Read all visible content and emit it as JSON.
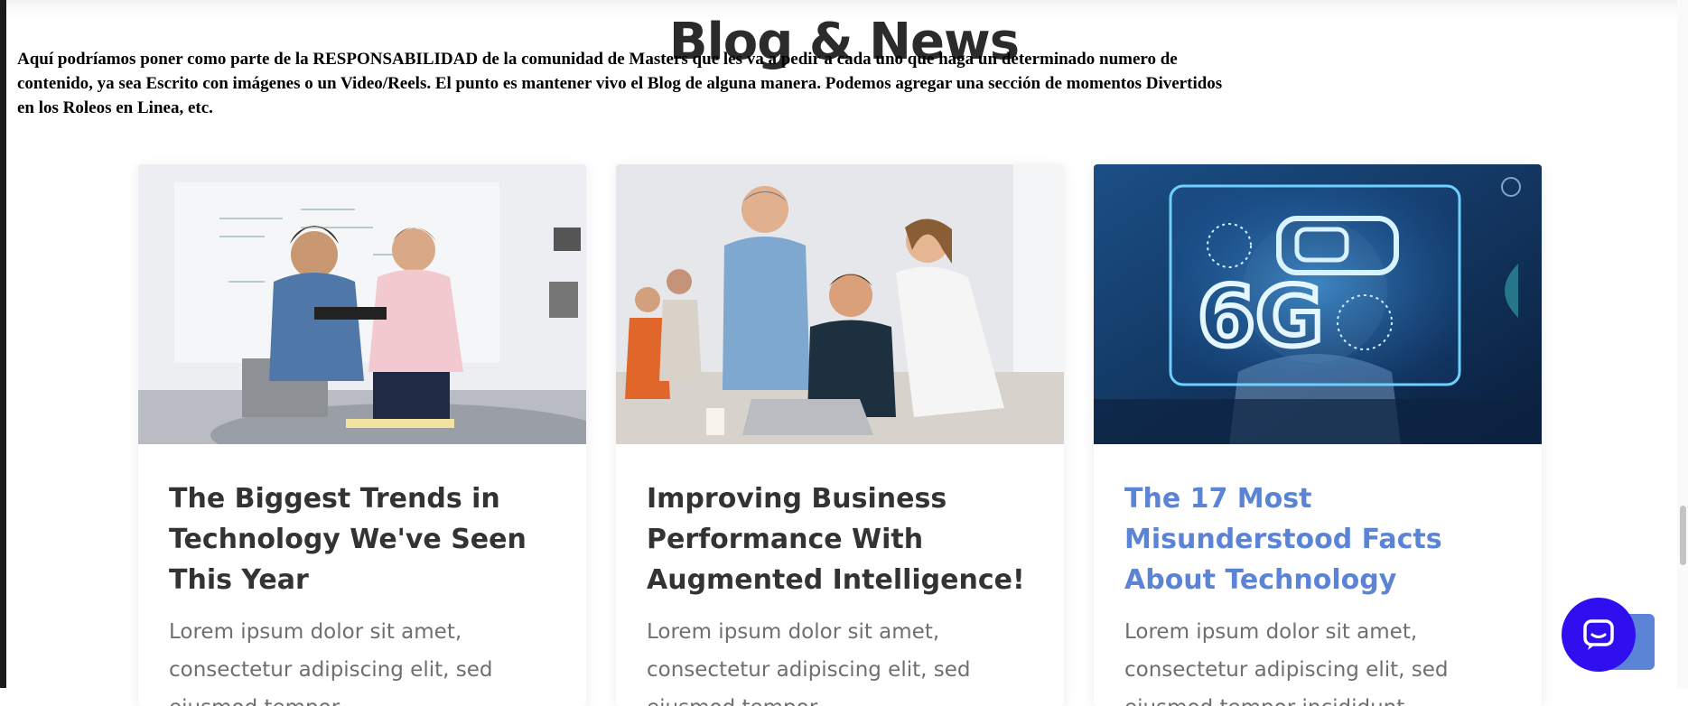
{
  "section": {
    "title": "Blog & News",
    "note": "Aquí podríamos poner como parte de la RESPONSABILIDAD de la comunidad de Masters que les va a pedir a cada uno que haga un determinado numero de contenido, ya sea Escrito con imágenes o un Video/Reels. El punto es mantener vivo el Blog de alguna manera. Podemos agregar una sección de momentos Divertidos en los Roleos en Linea, etc."
  },
  "posts": [
    {
      "title": "The Biggest Trends in Technology We've Seen This Year",
      "excerpt": "Lorem ipsum dolor sit amet, consectetur adipiscing elit, sed eiusmod tempor"
    },
    {
      "title": "Improving Business Performance With Augmented Intelligence!",
      "excerpt": "Lorem ipsum dolor sit amet, consectetur adipiscing elit, sed eiusmod tempor"
    },
    {
      "title": "The 17 Most Misunderstood Facts About Technology",
      "excerpt": "Lorem ipsum dolor sit amet, consectetur adipiscing elit, sed eiusmod tempor incididunt",
      "image_label": "6G"
    }
  ],
  "colors": {
    "accent": "#5b84d6",
    "chat": "#2f0ff0",
    "title": "#333333",
    "text": "#6f6f6f"
  },
  "icons": {
    "chat": "chat-bubble-icon",
    "scroll_top": "scroll-to-top-icon"
  }
}
